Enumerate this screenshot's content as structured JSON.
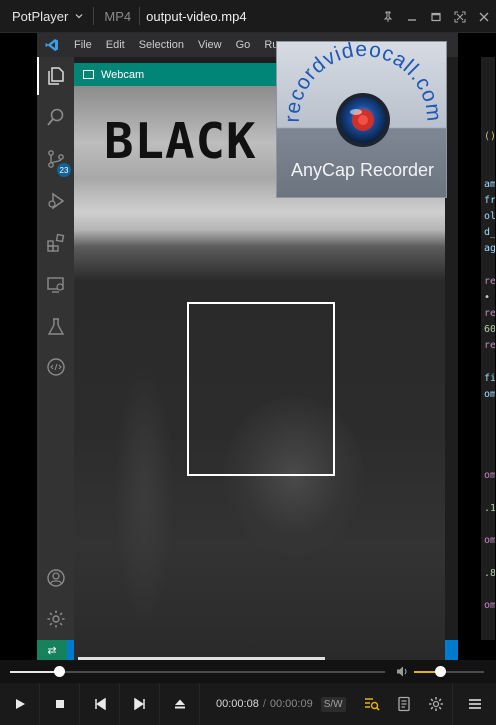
{
  "player": {
    "app_menu": "PotPlayer",
    "format": "MP4",
    "filename": "output-video.mp4"
  },
  "window_controls": [
    "pin-icon",
    "minimize-icon",
    "maximize-icon",
    "fullscreen-icon",
    "close-icon"
  ],
  "vscode": {
    "menu": [
      "File",
      "Edit",
      "Selection",
      "View",
      "Go",
      "Run"
    ],
    "scm_badge": "23",
    "code_fragments": [
      "()",
      "am",
      "fr",
      "ol",
      "d_",
      "ag",
      "re",
      "•",
      "re",
      "60",
      "re",
      "fi",
      "om",
      "om",
      ".1",
      "om",
      ".8",
      "om"
    ]
  },
  "webcam": {
    "title": "Webcam",
    "overlay_text": "BLACK"
  },
  "anycap": {
    "url_text": "recordvideocall.com",
    "product": "AnyCap Recorder"
  },
  "playback": {
    "current_time": "00:00:08",
    "total_time": "00:00:09",
    "sw_label": "S/W",
    "progress_fraction": 0.13,
    "volume_fraction": 0.37
  },
  "colors": {
    "volume_accent": "#e8b20a",
    "webcam_titlebar": "#008577",
    "vscode_statusbar": "#007acc"
  }
}
